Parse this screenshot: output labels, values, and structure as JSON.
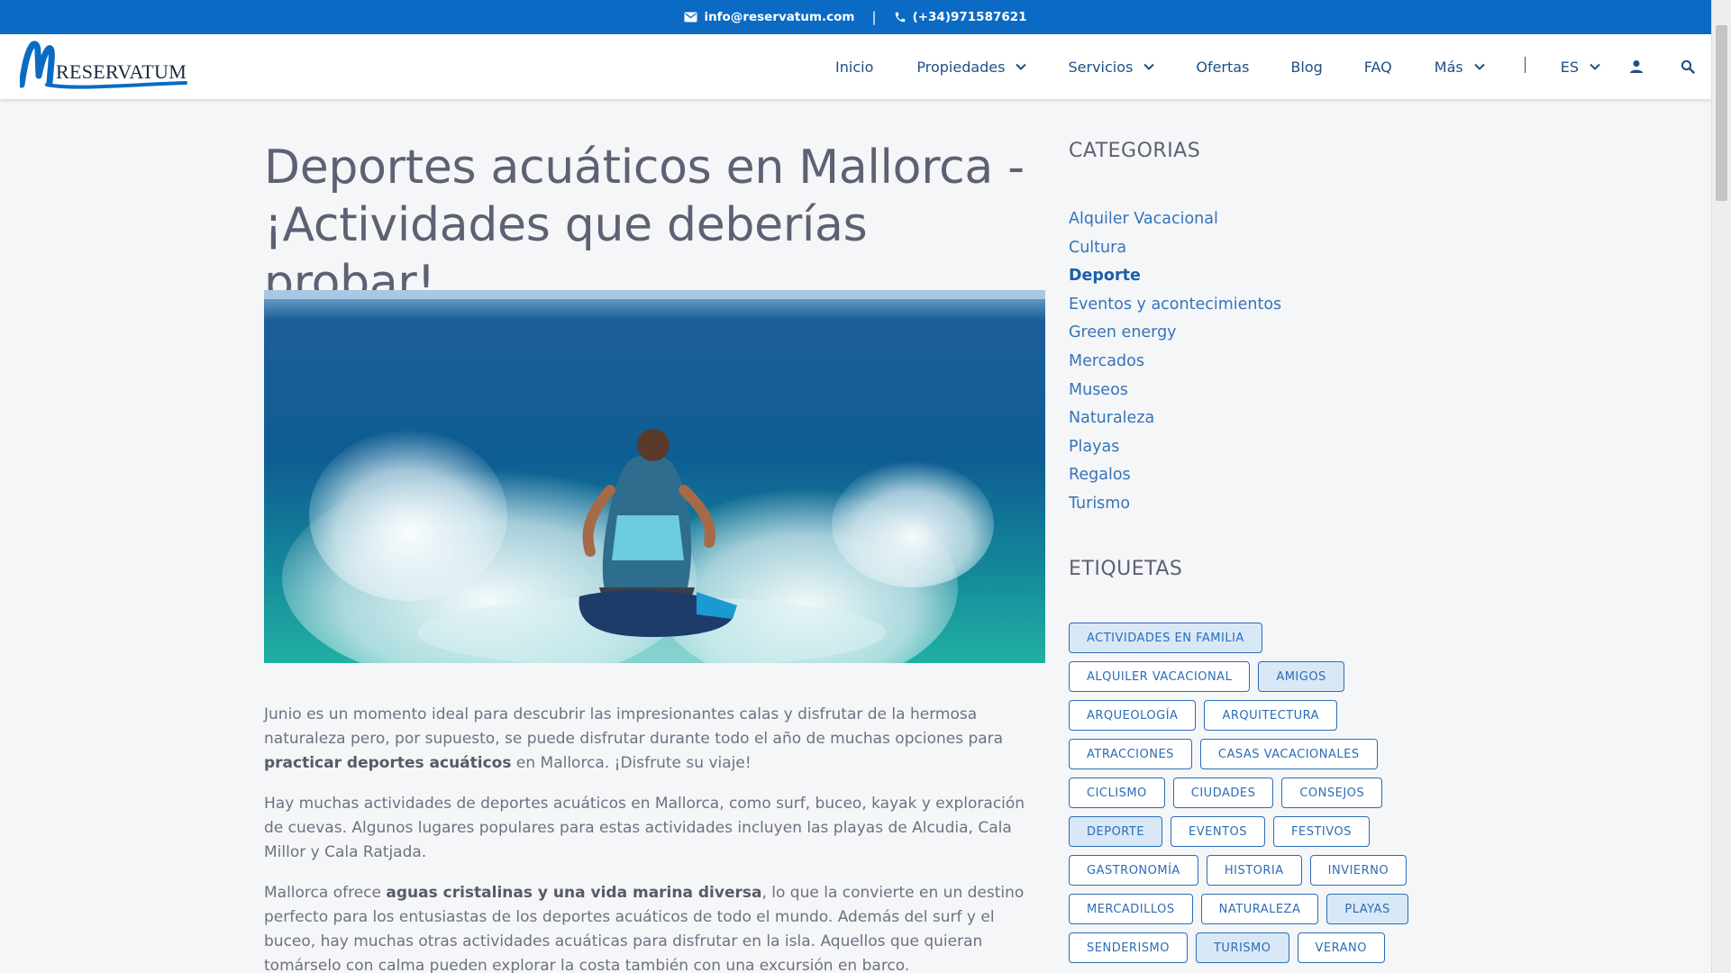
{
  "topbar": {
    "email": "info@reservatum.com",
    "separator": "|",
    "phone": "(+34)971587621"
  },
  "header": {
    "logo_text": "RESERVATUM",
    "nav": {
      "inicio": "Inicio",
      "propiedades": "Propiedades",
      "servicios": "Servicios",
      "ofertas": "Ofertas",
      "blog": "Blog",
      "faq": "FAQ",
      "mas": "Más",
      "language": "ES"
    }
  },
  "article": {
    "title": "Deportes acuáticos en Mallorca - ¡Actividades que deberías probar!",
    "p1": {
      "before": "Junio es un momento ideal para descubrir las impresionantes calas y disfrutar de la hermosa naturaleza pero, por supuesto, se puede disfrutar durante todo el año de muchas opciones para ",
      "bold": "practicar deportes acuáticos",
      "after": " en Mallorca. ¡Disfrute su viaje!"
    },
    "p2": "Hay muchas actividades de deportes acuáticos en Mallorca, como surf, buceo, kayak y exploración de cuevas. Algunos lugares populares para estas actividades incluyen las playas de Alcudia, Cala Millor y Cala Ratjada.",
    "p3": {
      "before": "Mallorca ofrece ",
      "bold": "aguas cristalinas y una vida marina diversa",
      "after": ", lo que la convierte en un destino perfecto para los entusiastas de los deportes acuáticos de todo el mundo. Además del surf y el buceo, hay muchas otras actividades acuáticas para disfrutar en la isla. Aquellos que quieran tomárselo con calma pueden explorar la costa también con una excursión en barco."
    }
  },
  "sidebar": {
    "categories_heading": "CATEGORIAS",
    "categories": [
      {
        "label": "Alquiler Vacacional",
        "active": false
      },
      {
        "label": "Cultura",
        "active": false
      },
      {
        "label": "Deporte",
        "active": true
      },
      {
        "label": "Eventos y acontecimientos",
        "active": false
      },
      {
        "label": "Green energy",
        "active": false
      },
      {
        "label": "Mercados",
        "active": false
      },
      {
        "label": "Museos",
        "active": false
      },
      {
        "label": "Naturaleza",
        "active": false
      },
      {
        "label": "Playas",
        "active": false
      },
      {
        "label": "Regalos",
        "active": false
      },
      {
        "label": "Turismo",
        "active": false
      }
    ],
    "tags_heading": "ETIQUETAS",
    "tags": [
      {
        "label": "ACTIVIDADES EN FAMILIA",
        "highlighted": true
      },
      {
        "label": "ALQUILER VACACIONAL",
        "highlighted": false
      },
      {
        "label": "AMIGOS",
        "highlighted": true
      },
      {
        "label": "ARQUEOLOGÍA",
        "highlighted": false
      },
      {
        "label": "ARQUITECTURA",
        "highlighted": false
      },
      {
        "label": "ATRACCIONES",
        "highlighted": false
      },
      {
        "label": "CASAS VACACIONALES",
        "highlighted": false
      },
      {
        "label": "CICLISMO",
        "highlighted": false
      },
      {
        "label": "CIUDADES",
        "highlighted": false
      },
      {
        "label": "CONSEJOS",
        "highlighted": false
      },
      {
        "label": "DEPORTE",
        "highlighted": true
      },
      {
        "label": "EVENTOS",
        "highlighted": false
      },
      {
        "label": "FESTIVOS",
        "highlighted": false
      },
      {
        "label": "GASTRONOMÍA",
        "highlighted": false
      },
      {
        "label": "HISTORIA",
        "highlighted": false
      },
      {
        "label": "INVIERNO",
        "highlighted": false
      },
      {
        "label": "MERCADILLOS",
        "highlighted": false
      },
      {
        "label": "NATURALEZA",
        "highlighted": false
      },
      {
        "label": "PLAYAS",
        "highlighted": true
      },
      {
        "label": "SENDERISMO",
        "highlighted": false
      },
      {
        "label": "TURISMO",
        "highlighted": true
      },
      {
        "label": "VERANO",
        "highlighted": false
      }
    ]
  },
  "colors": {
    "brand_blue": "#0b6bc4",
    "link_blue": "#3574b8",
    "heading_gray": "#5f6073",
    "tag_highlight": "#d9e8f7"
  },
  "icons": {
    "email": "mail-icon",
    "phone": "phone-icon",
    "dropdown": "chevron-down-icon",
    "account": "user-icon",
    "search": "search-icon"
  }
}
